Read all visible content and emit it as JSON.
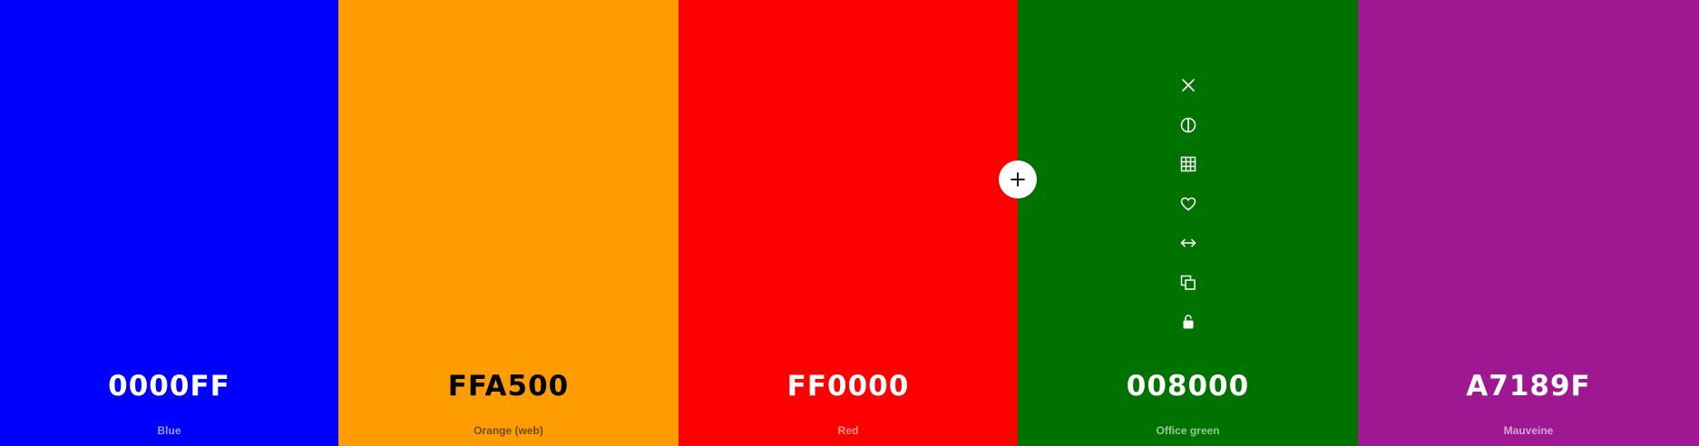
{
  "palette": {
    "swatches": [
      {
        "hex": "0000FF",
        "name": "Blue",
        "color": "#0000FF",
        "text_color": "#ffffff",
        "name_color": "rgba(255,255,255,0.6)"
      },
      {
        "hex": "FFA500",
        "name": "Orange (web)",
        "color": "#FF9D00",
        "text_color": "#000000",
        "name_color": "rgba(0,0,0,0.55)"
      },
      {
        "hex": "FF0000",
        "name": "Red",
        "color": "#FF0000",
        "text_color": "#ffffff",
        "name_color": "rgba(255,255,255,0.6)"
      },
      {
        "hex": "008000",
        "name": "Office green",
        "color": "#007200",
        "text_color": "#ffffff",
        "name_color": "rgba(255,255,255,0.6)"
      },
      {
        "hex": "A7189F",
        "name": "Mauveine",
        "color": "#9D1891",
        "text_color": "#ffffff",
        "name_color": "rgba(255,255,255,0.6)"
      }
    ],
    "hover_tools": [
      {
        "icon": "close-icon"
      },
      {
        "icon": "contrast-icon"
      },
      {
        "icon": "grid-icon"
      },
      {
        "icon": "heart-icon"
      },
      {
        "icon": "drag-horizontal-icon"
      },
      {
        "icon": "copy-icon"
      },
      {
        "icon": "unlock-icon"
      }
    ],
    "add_button": {
      "icon": "plus-icon"
    }
  }
}
